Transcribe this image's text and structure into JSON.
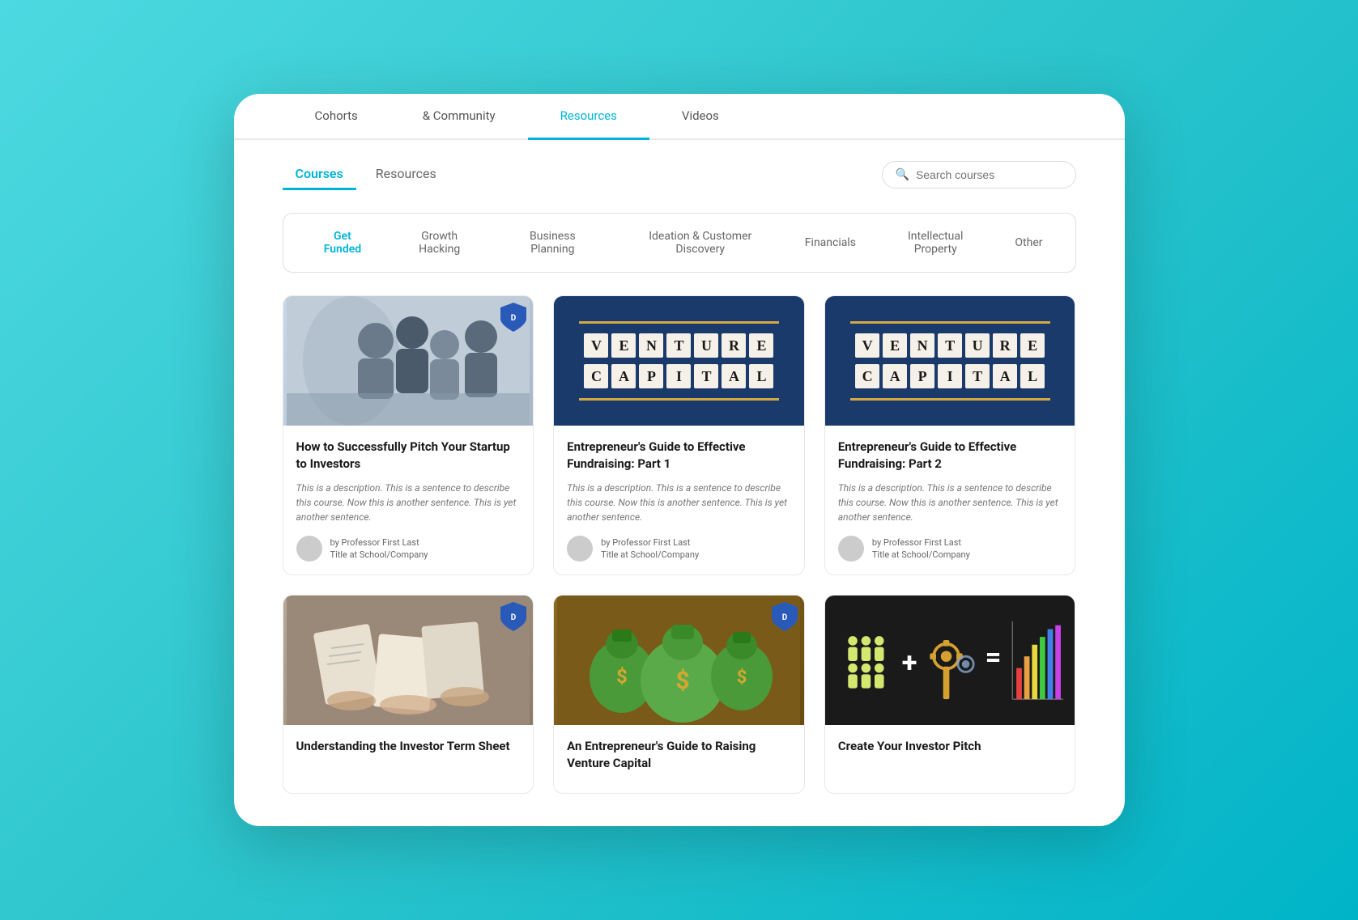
{
  "topNav": {
    "items": [
      {
        "label": "Cohorts",
        "active": false
      },
      {
        "label": "& Community",
        "active": false
      },
      {
        "label": "Resources",
        "active": true
      },
      {
        "label": "Videos",
        "active": false
      }
    ]
  },
  "tabs": {
    "items": [
      {
        "label": "Courses",
        "active": true
      },
      {
        "label": "Resources",
        "active": false
      }
    ]
  },
  "search": {
    "placeholder": "Search courses"
  },
  "categories": {
    "items": [
      {
        "label": "Get Funded",
        "active": true
      },
      {
        "label": "Growth Hacking",
        "active": false
      },
      {
        "label": "Business Planning",
        "active": false
      },
      {
        "label": "Ideation & Customer Discovery",
        "active": false
      },
      {
        "label": "Financials",
        "active": false
      },
      {
        "label": "Intellectual Property",
        "active": false
      },
      {
        "label": "Other",
        "active": false
      }
    ]
  },
  "courses": [
    {
      "id": 1,
      "title": "How to Successfully Pitch Your Startup to Investors",
      "description": "This is a description. This is a sentence to describe this course. Now this is another sentence. This is yet another sentence.",
      "author": "by Professor First Last",
      "authorTitle": "Title at School/Company",
      "thumbType": "team",
      "hasShield": true
    },
    {
      "id": 2,
      "title": "Entrepreneur's Guide to Effective Fundraising: Part 1",
      "description": "This is a description. This is a sentence to describe this course. Now this is another sentence. This is yet another sentence.",
      "author": "by Professor First Last",
      "authorTitle": "Title at School/Company",
      "thumbType": "vc",
      "hasShield": false
    },
    {
      "id": 3,
      "title": "Entrepreneur's Guide to Effective Fundraising: Part 2",
      "description": "This is a description. This is a sentence to describe this course. Now this is another sentence. This is yet another sentence.",
      "author": "by Professor First Last",
      "authorTitle": "Title at School/Company",
      "thumbType": "vc",
      "hasShield": false
    },
    {
      "id": 4,
      "title": "Understanding the Investor Term Sheet",
      "description": "",
      "author": "",
      "authorTitle": "",
      "thumbType": "docs",
      "hasShield": true
    },
    {
      "id": 5,
      "title": "An Entrepreneur's Guide to Raising Venture Capital",
      "description": "",
      "author": "",
      "authorTitle": "",
      "thumbType": "money",
      "hasShield": true
    },
    {
      "id": 6,
      "title": "Create Your Investor Pitch",
      "description": "",
      "author": "",
      "authorTitle": "",
      "thumbType": "chart",
      "hasShield": false
    }
  ],
  "colors": {
    "accent": "#00b4d8",
    "activeNav": "#00b4d8"
  }
}
